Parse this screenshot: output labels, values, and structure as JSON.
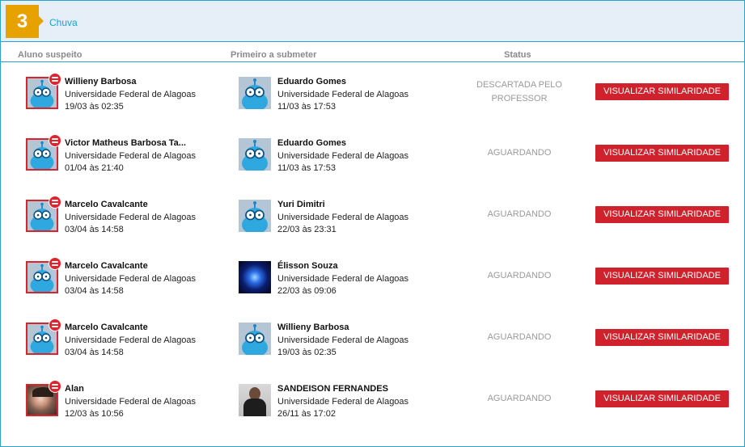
{
  "header": {
    "step_number": "3",
    "title": "Chuva"
  },
  "columns": {
    "suspect": "Aluno suspeito",
    "first": "Primeiro a submeter",
    "status": "Status"
  },
  "colors": {
    "accent": "#29a3c7",
    "badge": "#e8a200",
    "button": "#d0222d",
    "block_icon": "#e3232c"
  },
  "rows": [
    {
      "suspect": {
        "name": "Willieny Barbosa",
        "university": "Universidade Federal de Alagoas",
        "date": "19/03 às 02:35",
        "avatar": "default-avatar"
      },
      "first": {
        "name": "Eduardo Gomes",
        "university": "Universidade Federal de Alagoas",
        "date": "11/03 às 17:53",
        "avatar": "default-avatar"
      },
      "status": "DESCARTADA PELO PROFESSOR",
      "button": "VISUALIZAR SIMILARIDADE"
    },
    {
      "suspect": {
        "name": "Victor Matheus Barbosa Ta...",
        "university": "Universidade Federal de Alagoas",
        "date": "01/04 às 21:40",
        "avatar": "default-avatar"
      },
      "first": {
        "name": "Eduardo Gomes",
        "university": "Universidade Federal de Alagoas",
        "date": "11/03 às 17:53",
        "avatar": "default-avatar"
      },
      "status": "AGUARDANDO",
      "button": "VISUALIZAR SIMILARIDADE"
    },
    {
      "suspect": {
        "name": "Marcelo Cavalcante",
        "university": "Universidade Federal de Alagoas",
        "date": "03/04 às 14:58",
        "avatar": "default-avatar"
      },
      "first": {
        "name": "Yuri Dimitri",
        "university": "Universidade Federal de Alagoas",
        "date": "22/03 às 23:31",
        "avatar": "default-avatar"
      },
      "status": "AGUARDANDO",
      "button": "VISUALIZAR SIMILARIDADE"
    },
    {
      "suspect": {
        "name": "Marcelo Cavalcante",
        "university": "Universidade Federal de Alagoas",
        "date": "03/04 às 14:58",
        "avatar": "default-avatar"
      },
      "first": {
        "name": "Élisson Souza",
        "university": "Universidade Federal de Alagoas",
        "date": "22/03 às 09:06",
        "avatar": "photo-avatar"
      },
      "status": "AGUARDANDO",
      "button": "VISUALIZAR SIMILARIDADE"
    },
    {
      "suspect": {
        "name": "Marcelo Cavalcante",
        "university": "Universidade Federal de Alagoas",
        "date": "03/04 às 14:58",
        "avatar": "default-avatar"
      },
      "first": {
        "name": "Willieny Barbosa",
        "university": "Universidade Federal de Alagoas",
        "date": "19/03 às 02:35",
        "avatar": "default-avatar"
      },
      "status": "AGUARDANDO",
      "button": "VISUALIZAR SIMILARIDADE"
    },
    {
      "suspect": {
        "name": "Alan",
        "university": "Universidade Federal de Alagoas",
        "date": "12/03 às 10:56",
        "avatar": "photo-avatar"
      },
      "first": {
        "name": "SANDEISON FERNANDES",
        "university": "Universidade Federal de Alagoas",
        "date": "26/11 às 17:02",
        "avatar": "photo-avatar"
      },
      "status": "AGUARDANDO",
      "button": "VISUALIZAR SIMILARIDADE"
    }
  ]
}
